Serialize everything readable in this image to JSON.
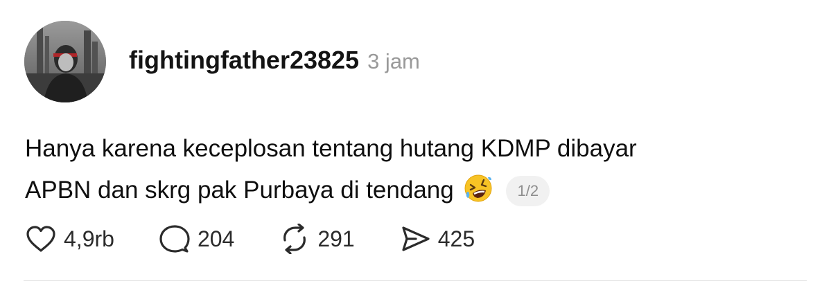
{
  "post": {
    "username": "fightingfather23825",
    "time": "3 jam",
    "text_line1": "Hanya karena keceplosan tentang hutang KDMP dibayar",
    "text_line2": "APBN dan skrg pak Purbaya di tendang",
    "emoji": "rolling-on-the-floor-laughing",
    "thread_counter": "1/2"
  },
  "actions": {
    "likes": "4,9rb",
    "comments": "204",
    "reposts": "291",
    "shares": "425"
  },
  "icons": {
    "like": "heart-icon",
    "comment": "speech-bubble-icon",
    "repost": "repost-arrows-icon",
    "share": "send-arrow-icon"
  }
}
